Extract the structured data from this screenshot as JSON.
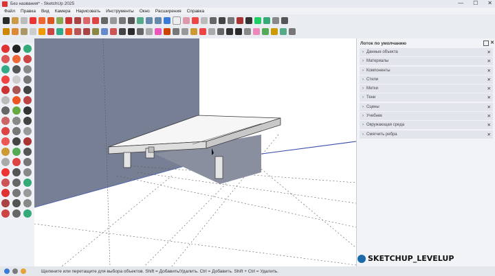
{
  "window": {
    "title": "Без названия* - SketchUp 2025",
    "minimize": "—",
    "maximize": "☐",
    "close": "✕"
  },
  "menu": [
    "Файл",
    "Правка",
    "Вид",
    "Камера",
    "Нарисовать",
    "Инструменты",
    "Окно",
    "Расширения",
    "Справка"
  ],
  "tray": {
    "title": "Лоток по умолчанию",
    "panels": [
      {
        "label": "Данные объекта"
      },
      {
        "label": "Материалы"
      },
      {
        "label": "Компоненты"
      },
      {
        "label": "Стили"
      },
      {
        "label": "Метки"
      },
      {
        "label": "Тени"
      },
      {
        "label": "Сцены"
      },
      {
        "label": "Учебник"
      },
      {
        "label": "Окружающая среда"
      },
      {
        "label": "Смягчить ребра"
      }
    ]
  },
  "status": {
    "hint": "Щелкните или перетащите для выбора объектов. Shift = Добавить/Удалить. Ctrl = Добавить. Shift + Ctrl = Удалить."
  },
  "watermark": {
    "text": "SKETCHUP_LEVELUP"
  },
  "icons": [
    "select-icon",
    "eraser-icon",
    "paint-bucket-icon",
    "line-icon",
    "arc-icon",
    "rectangle-icon",
    "push-pull-icon",
    "move-icon",
    "rotate-icon",
    "scale-icon",
    "offset-icon",
    "tape-measure-icon",
    "orbit-icon",
    "pan-icon",
    "zoom-icon"
  ],
  "colors": {
    "wall": "#777f95",
    "viewport_bg": "#ffffff",
    "slab": "#f3f3f3",
    "accent": "#1a6aa8"
  }
}
